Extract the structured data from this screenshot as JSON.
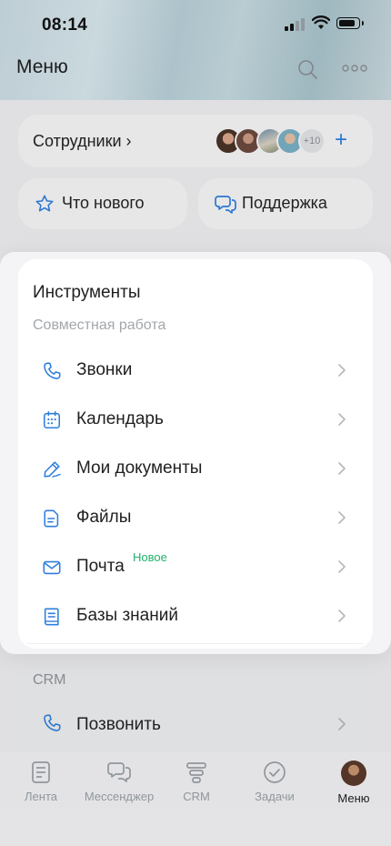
{
  "status_bar": {
    "time": "08:14"
  },
  "header": {
    "title": "Меню"
  },
  "employees": {
    "label": "Сотрудники ›",
    "more_count": "+10",
    "add_symbol": "+"
  },
  "quick_actions": [
    {
      "label": "Что нового",
      "icon": "star-icon"
    },
    {
      "label": "Поддержка",
      "icon": "chat-icon"
    }
  ],
  "tools": {
    "title": "Инструменты",
    "section": "Совместная работа",
    "items": [
      {
        "label": "Звонки",
        "icon": "phone-icon"
      },
      {
        "label": "Календарь",
        "icon": "calendar-icon"
      },
      {
        "label": "Мои документы",
        "icon": "pen-icon"
      },
      {
        "label": "Файлы",
        "icon": "file-icon"
      },
      {
        "label": "Почта",
        "icon": "mail-icon",
        "badge": "Новое"
      },
      {
        "label": "Базы знаний",
        "icon": "book-icon"
      }
    ]
  },
  "crm": {
    "section": "CRM",
    "items": [
      {
        "label": "Позвонить",
        "icon": "phone-icon"
      }
    ]
  },
  "tabbar": {
    "items": [
      {
        "label": "Лента",
        "icon": "feed-icon"
      },
      {
        "label": "Мессенджер",
        "icon": "messenger-icon"
      },
      {
        "label": "CRM",
        "icon": "crm-icon"
      },
      {
        "label": "Задачи",
        "icon": "tasks-icon"
      },
      {
        "label": "Меню",
        "icon": "avatar"
      }
    ],
    "active": "Меню"
  },
  "colors": {
    "accent": "#2f7fdd",
    "badge_green": "#23b26a",
    "secondary_text": "#a3a7ab"
  }
}
